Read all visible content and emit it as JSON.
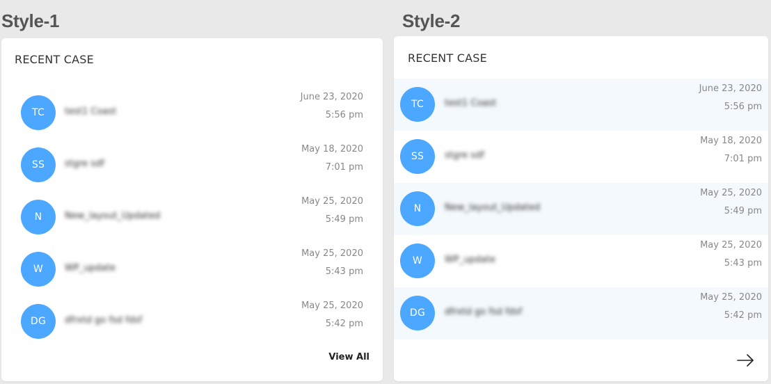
{
  "styles": [
    {
      "label": "Style-1"
    },
    {
      "label": "Style-2"
    }
  ],
  "card_title": "RECENT CASE",
  "view_all_label": "View All",
  "colors": {
    "avatar_bg": "#4ba7ff",
    "row_highlight": "#f3f9fd",
    "page_bg": "#e9e9e9"
  },
  "icons": {
    "next": "arrow-right-icon"
  },
  "cases": [
    {
      "initials": "TC",
      "name": "test1 Coast",
      "date": "June 23, 2020",
      "time": "5:56 pm"
    },
    {
      "initials": "SS",
      "name": "stgre sdf",
      "date": "May 18, 2020",
      "time": "7:01 pm"
    },
    {
      "initials": "N",
      "name": "New_layout_Updated",
      "date": "May 25, 2020",
      "time": "5:49 pm"
    },
    {
      "initials": "W",
      "name": "WP_update",
      "date": "May 25, 2020",
      "time": "5:43 pm"
    },
    {
      "initials": "DG",
      "name": "dfrxtd go fsd fdsf",
      "date": "May 25, 2020",
      "time": "5:42 pm"
    }
  ]
}
